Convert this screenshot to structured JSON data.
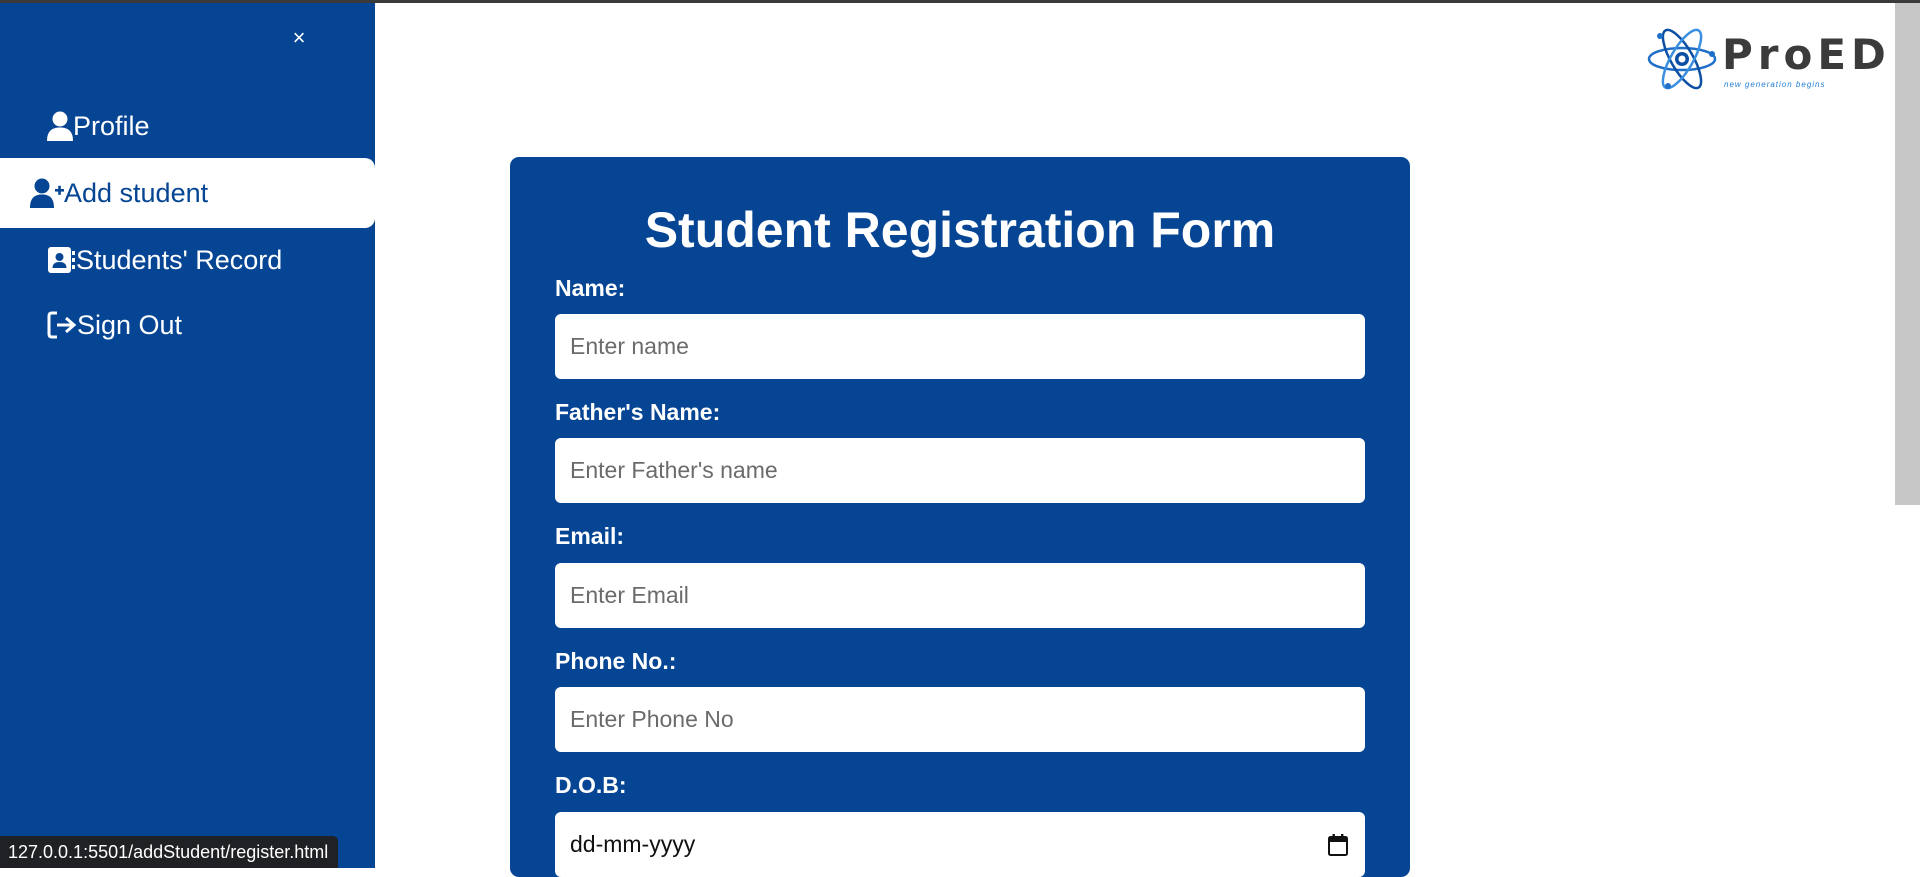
{
  "sidebar": {
    "close_label": "×",
    "items": [
      {
        "label": "Profile",
        "icon": "user-icon"
      },
      {
        "label": "Add student",
        "icon": "user-plus-icon",
        "active": true
      },
      {
        "label": "Students' Record",
        "icon": "address-book-icon"
      },
      {
        "label": "Sign Out",
        "icon": "sign-out-icon"
      }
    ]
  },
  "logo": {
    "text": "ProED",
    "tagline": "new generation begins"
  },
  "form": {
    "title": "Student Registration Form",
    "fields": {
      "name": {
        "label": "Name:",
        "placeholder": "Enter name"
      },
      "father_name": {
        "label": "Father's Name:",
        "placeholder": "Enter Father's name"
      },
      "email": {
        "label": "Email:",
        "placeholder": "Enter Email"
      },
      "phone": {
        "label": "Phone No.:",
        "placeholder": "Enter Phone No"
      },
      "dob": {
        "label": "D.O.B:",
        "placeholder": "dd-mm-yyyy"
      }
    }
  },
  "status_bar": {
    "url": "127.0.0.1:5501/addStudent/register.html"
  },
  "colors": {
    "primary": "#054593",
    "white": "#ffffff",
    "logo_text": "#3b3b3b",
    "logo_accent": "#1f7ed8"
  }
}
